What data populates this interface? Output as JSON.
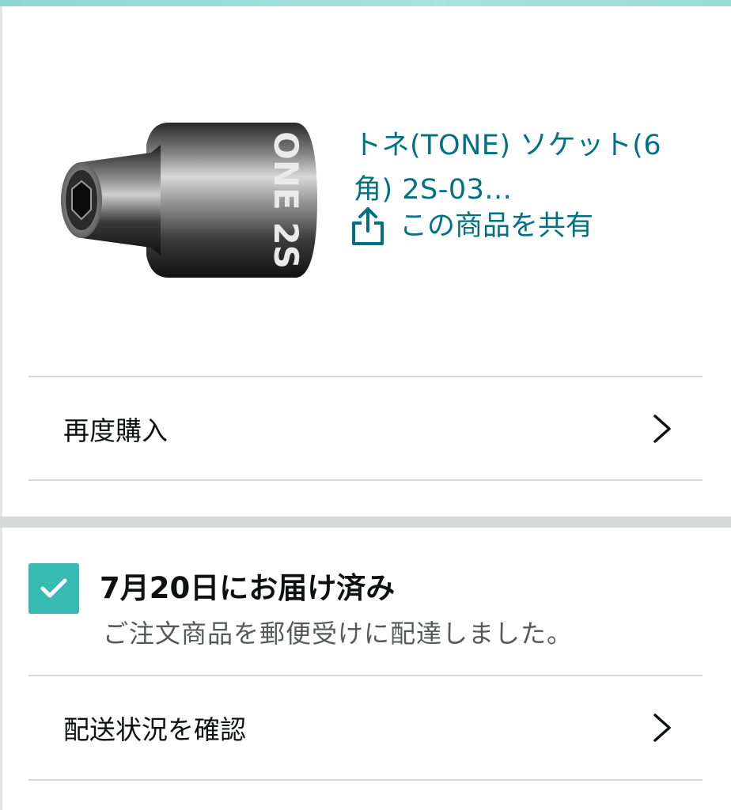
{
  "product": {
    "title": "トネ(TONE) ソケット(6角) 2S-03...",
    "share_label": "この商品を共有",
    "share_icon": "share-icon",
    "image_icon": "hex-socket-image"
  },
  "actions": {
    "buy_again_label": "再度購入",
    "track_label": "配送状況を確認",
    "chevron_icon": "chevron-right-icon"
  },
  "delivery": {
    "status_title": "7月20日にお届け済み",
    "status_detail": "ご注文商品を郵便受けに配達しました。",
    "status_icon": "check-icon",
    "status_color": "#37bbb0"
  },
  "colors": {
    "link": "#007185",
    "divider": "#d5d9d9",
    "text": "#0f1111",
    "muted": "#565959"
  }
}
